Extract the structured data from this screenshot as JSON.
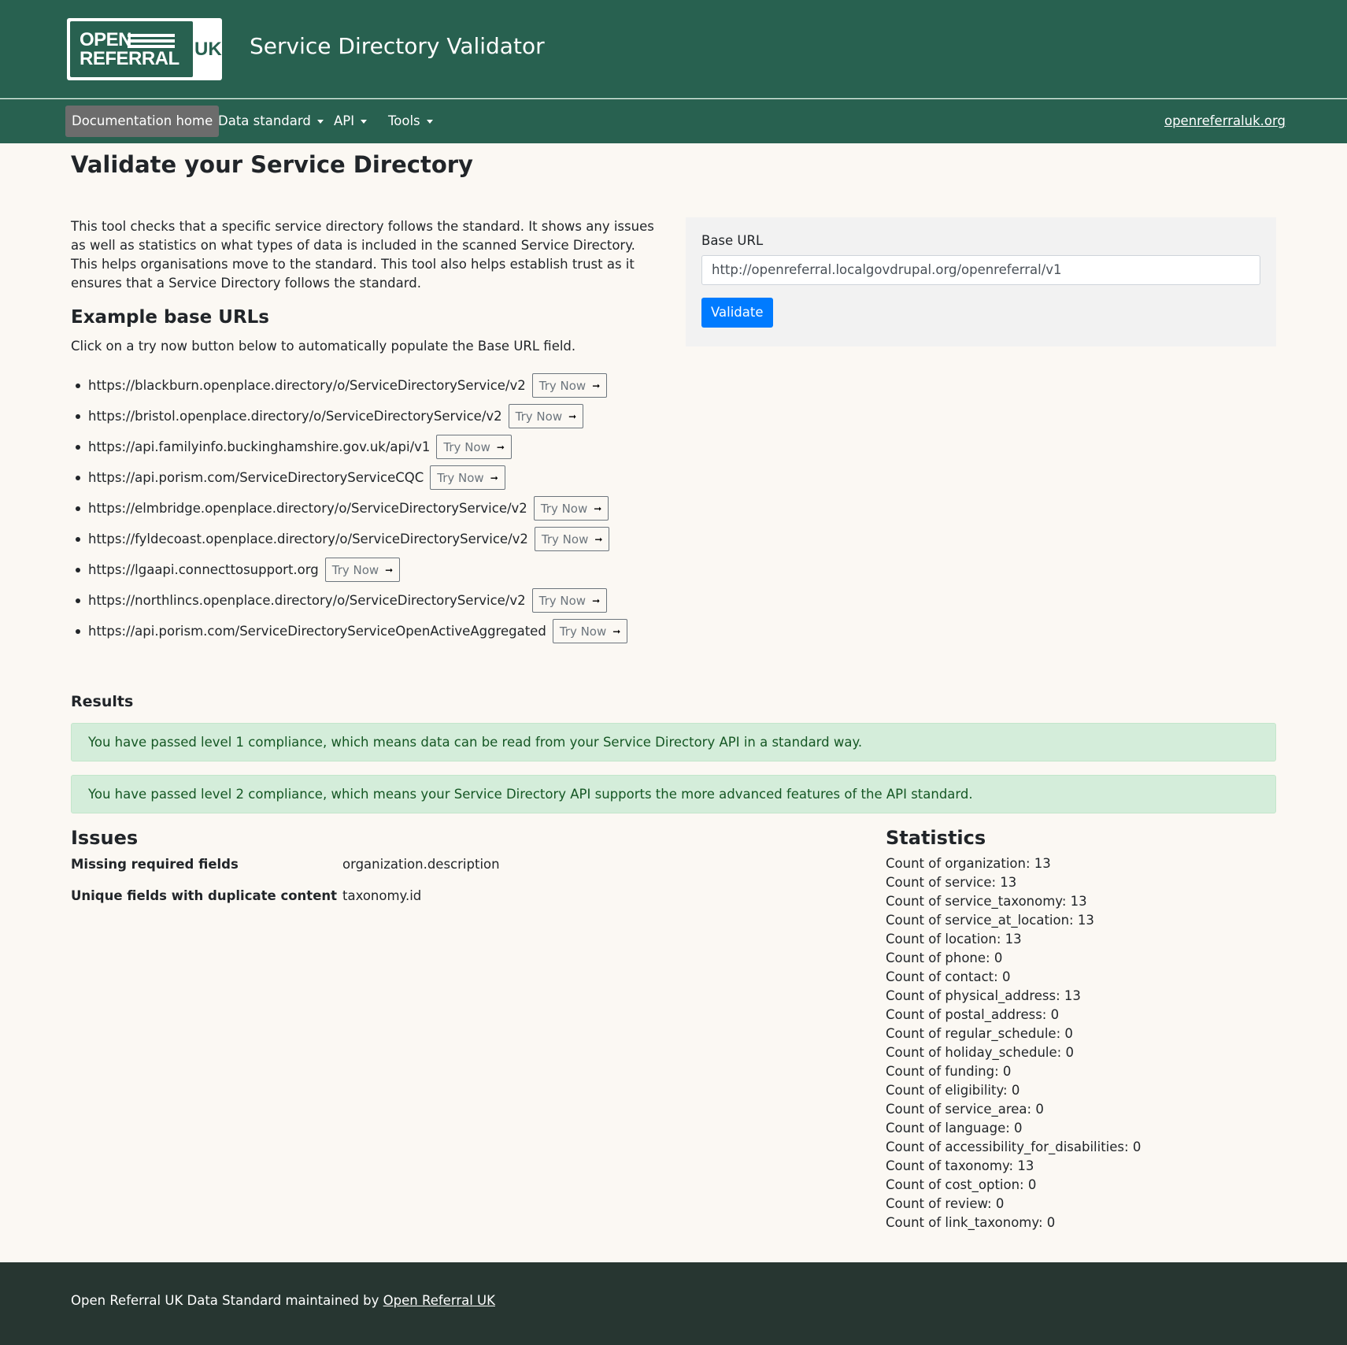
{
  "header": {
    "logo_text": [
      "OPEN",
      "REFERRAL",
      "UK"
    ],
    "title": "Service Directory Validator"
  },
  "nav": {
    "items": [
      {
        "label": "Documentation home"
      },
      {
        "label": "Data standard"
      },
      {
        "label": "API"
      },
      {
        "label": "Tools"
      }
    ],
    "external_link": "openreferraluk.org"
  },
  "page": {
    "title": "Validate your Service Directory",
    "intro": "This tool checks that a specific service directory follows the standard. It shows any issues as well as statistics on what types of data is included in the scanned Service Directory. This helps organisations move to the standard. This tool also helps establish trust as it ensures that a Service Directory follows the standard.",
    "examples_heading": "Example base URLs",
    "examples_hint": "Click on a try now button below to automatically populate the Base URL field.",
    "try_label": "Try Now",
    "examples": [
      "https://blackburn.openplace.directory/o/ServiceDirectoryService/v2",
      "https://bristol.openplace.directory/o/ServiceDirectoryService/v2",
      "https://api.familyinfo.buckinghamshire.gov.uk/api/v1",
      "https://api.porism.com/ServiceDirectoryServiceCQC",
      "https://elmbridge.openplace.directory/o/ServiceDirectoryService/v2",
      "https://fyldecoast.openplace.directory/o/ServiceDirectoryService/v2",
      "https://lgaapi.connecttosupport.org",
      "https://northlincs.openplace.directory/o/ServiceDirectoryService/v2",
      "https://api.porism.com/ServiceDirectoryServiceOpenActiveAggregated"
    ]
  },
  "form": {
    "label": "Base URL",
    "value": "http://openreferral.localgovdrupal.org/openreferral/v1",
    "button": "Validate"
  },
  "results": {
    "heading": "Results",
    "alerts": [
      "You have passed level 1 compliance, which means data can be read from your Service Directory API in a standard way.",
      "You have passed level 2 compliance, which means your Service Directory API supports the more advanced features of the API standard."
    ],
    "issues_heading": "Issues",
    "issues": [
      {
        "label": "Missing required fields",
        "value": "organization.description"
      },
      {
        "label": "Unique fields with duplicate content",
        "value": "taxonomy.id"
      }
    ],
    "stats_heading": "Statistics",
    "stats": [
      "Count of organization: 13",
      "Count of service: 13",
      "Count of service_taxonomy: 13",
      "Count of service_at_location: 13",
      "Count of location: 13",
      "Count of phone: 0",
      "Count of contact: 0",
      "Count of physical_address: 13",
      "Count of postal_address: 0",
      "Count of regular_schedule: 0",
      "Count of holiday_schedule: 0",
      "Count of funding: 0",
      "Count of eligibility: 0",
      "Count of service_area: 0",
      "Count of language: 0",
      "Count of accessibility_for_disabilities: 0",
      "Count of taxonomy: 13",
      "Count of cost_option: 0",
      "Count of review: 0",
      "Count of link_taxonomy: 0"
    ]
  },
  "footer": {
    "text": "Open Referral UK Data Standard maintained by ",
    "link": "Open Referral UK"
  }
}
